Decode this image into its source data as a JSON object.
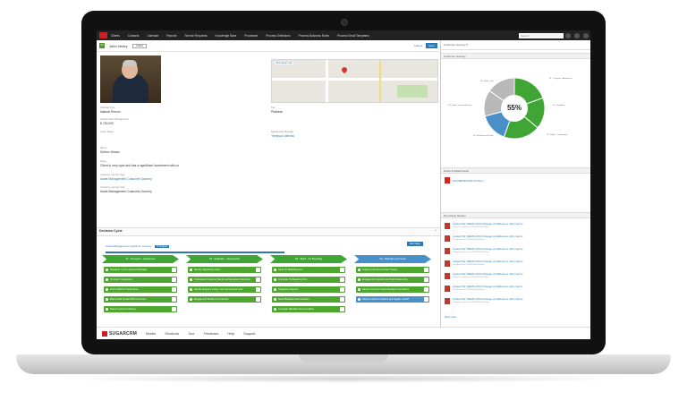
{
  "nav": {
    "items": [
      "Clients",
      "Contacts",
      "Calendar",
      "Reports",
      "Service Requests",
      "Knowledge Base",
      "Processes",
      "Process Definitions",
      "Process Business Rules",
      "Process Email Templates"
    ],
    "search_placeholder": "Search"
  },
  "record": {
    "name": "John Henry",
    "icon_text": "Cli",
    "follow_label": "Follow",
    "cancel_label": "Cancel",
    "save_label": "Save",
    "big_map_label": "View larger map",
    "fields": {
      "client_type_label": "Clientele Type",
      "client_type_value": "Natural Person",
      "tier_label": "Tier",
      "tier_value": "Platinum",
      "assets_label": "Assets Under Management",
      "assets_value": "$ 752,000",
      "status_label": "Active Status",
      "rm_label": "Relationship Manager",
      "rm_value": "Temeyca Valenta",
      "name_label": "Name",
      "name_value": "Dietrox Wraan",
      "notes_label": "Notes",
      "notes_value": "Client is very loyal and has a significant investment with us",
      "journey_tag_label": "Customer Journey Tags",
      "journey_tag_value": "Asset Management Customer Journey",
      "journey_type_label": "Customer Journey Type",
      "journey_type_value": "Asset Management Customer Journey"
    }
  },
  "decision_cycle": {
    "title": "Decision Cycle",
    "journey_link": "Asset Management Customer Journey",
    "journey_badge": "In Progress",
    "edit_stage_label": "Edit Stage",
    "stages": [
      {
        "label": "01 - Prospect - Awareness",
        "color": "#3fa535"
      },
      {
        "label": "02 - Establish - Opportunity",
        "color": "#3fa535"
      },
      {
        "label": "03 - Build - On Boarding",
        "color": "#3fa535"
      },
      {
        "label": "04 - Maintain and Grow",
        "color": "#4a90c8"
      }
    ],
    "tasks": [
      [
        "Research on firm and fund Manager",
        "On-Fund Comparison",
        "Invite CMS for Presentation",
        "Make initial Contact With Customer",
        "Setup Customer Meeting"
      ],
      [
        "Identify Opportunity Team",
        "Understand Customer Needs and Expected Outcomes",
        "Identify targeted, scope, and risk tolerance and",
        "Engage and Present to Customer"
      ],
      [
        "Send On Boarding form",
        "Complete On Boarding form",
        "Regulatory Reports",
        "Send Mandate documentation",
        "Complete Mandate Documentation"
      ],
      [
        "Judge Fund plans Contact Person",
        "Engage with investors and build relationship",
        "Advise Customer about Mandate Compliance",
        "Setup Customer Updates and regular contact"
      ]
    ]
  },
  "right": {
    "top_label": "Customer Journey ▾",
    "journey_panel": "Customer Journey",
    "percent": "55%",
    "donut_labels": [
      "03 - Build - Exit",
      "01 - Prospect - Awareness",
      "02 - Establish",
      "03 - Build - On Boarding",
      "04 - Maintain and Grow",
      "03 - Build - Internal Review"
    ],
    "notes_panel": "Notes & Attachments",
    "note_file": "FICA08/03/2018 02:15pm",
    "activity_panel": "My Activity Stream",
    "stream": [
      {
        "title": "Linked FW: DEMO-0704 Change of Address to John Henry",
        "sub": "Temeyca Valenta on 07/06/2018 04:50pm"
      },
      {
        "title": "Linked FW: DEMO-0704 Change of Address to John Henry",
        "sub": "Joe Bastian on 07/06/2018 04:50pm"
      },
      {
        "title": "Linked FW: DEMO-0704 Change of Address to John Henry",
        "sub": "Temeyca Valenta on 07/06/2018 04:50pm"
      },
      {
        "title": "Linked FW: DEMO-0704 Change of Address to John Henry",
        "sub": "Joe Bastian on 07/06/2018 04:50pm"
      },
      {
        "title": "Linked FW: DEMO-0704 Change of Address to John Henry",
        "sub": "Temeyca Valenta on 07/06/2018 04:50pm"
      },
      {
        "title": "Linked FW: DEMO-0704 Change of Address to John Henry",
        "sub": "Joe Bastian on 07/06/2018 04:50pm"
      },
      {
        "title": "Linked FW: DEMO-0704 Change of Address to John Henry",
        "sub": "Temeyca Valenta on 07/06/2018 04:50pm"
      }
    ],
    "more_label": "More posts..."
  },
  "footer": {
    "brand": "SUGARCRM",
    "sugar_small": "SugarCRM",
    "items": [
      "Mobile",
      "Shortcuts",
      "Tour",
      "Feedback",
      "Help",
      "Support"
    ]
  },
  "colors": {
    "green": "#3fa535",
    "blue": "#4a90c8",
    "gray": "#b8b8b8",
    "brand_red": "#c91f25"
  }
}
